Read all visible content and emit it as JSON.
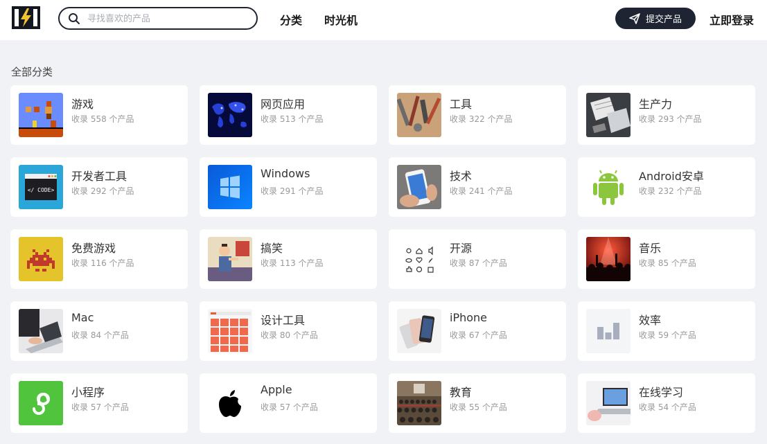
{
  "header": {
    "search": {
      "placeholder": "寻找喜欢的产品",
      "value": ""
    },
    "nav": [
      {
        "label": "分类"
      },
      {
        "label": "时光机"
      }
    ],
    "submit_label": "提交产品",
    "login_label": "立即登录"
  },
  "main": {
    "section_title": "全部分类",
    "categories": [
      {
        "name": "游戏",
        "count": "收录 558 个产品",
        "icon": "mario-game-thumbnail"
      },
      {
        "name": "网页应用",
        "count": "收录 513 个产品",
        "icon": "world-map-thumbnail"
      },
      {
        "name": "工具",
        "count": "收录 322 个产品",
        "icon": "tools-thumbnail"
      },
      {
        "name": "生产力",
        "count": "收录 293 个产品",
        "icon": "desk-thumbnail"
      },
      {
        "name": "开发者工具",
        "count": "收录 292 个产品",
        "icon": "code-window-thumbnail"
      },
      {
        "name": "Windows",
        "count": "收录 291 个产品",
        "icon": "windows-logo-thumbnail"
      },
      {
        "name": "技术",
        "count": "收录 241 个产品",
        "icon": "phone-in-hand-thumbnail"
      },
      {
        "name": "Android安卓",
        "count": "收录 232 个产品",
        "icon": "android-robot-thumbnail"
      },
      {
        "name": "免费游戏",
        "count": "收录 116 个产品",
        "icon": "pixel-invader-thumbnail"
      },
      {
        "name": "搞笑",
        "count": "收录 113 个产品",
        "icon": "cartoon-thumbnail"
      },
      {
        "name": "开源",
        "count": "收录 87 个产品",
        "icon": "icon-set-thumbnail"
      },
      {
        "name": "音乐",
        "count": "收录 85 个产品",
        "icon": "concert-thumbnail"
      },
      {
        "name": "Mac",
        "count": "收录 84 个产品",
        "icon": "laptop-typing-thumbnail"
      },
      {
        "name": "设计工具",
        "count": "收录 80 个产品",
        "icon": "design-grid-thumbnail"
      },
      {
        "name": "iPhone",
        "count": "收录 67 个产品",
        "icon": "iphones-thumbnail"
      },
      {
        "name": "效率",
        "count": "收录 59 个产品",
        "icon": "bar-chart-thumbnail"
      },
      {
        "name": "小程序",
        "count": "收录 57 个产品",
        "icon": "mini-program-thumbnail"
      },
      {
        "name": "Apple",
        "count": "收录 57 个产品",
        "icon": "apple-logo-thumbnail"
      },
      {
        "name": "教育",
        "count": "收录 55 个产品",
        "icon": "lecture-hall-thumbnail"
      },
      {
        "name": "在线学习",
        "count": "收录 54 个产品",
        "icon": "online-learning-thumbnail"
      }
    ]
  },
  "colors": {
    "page_bg": "#f0f2f5",
    "primary_dark": "#1f2433",
    "card_bg": "#ffffff",
    "muted_text": "#999999"
  }
}
